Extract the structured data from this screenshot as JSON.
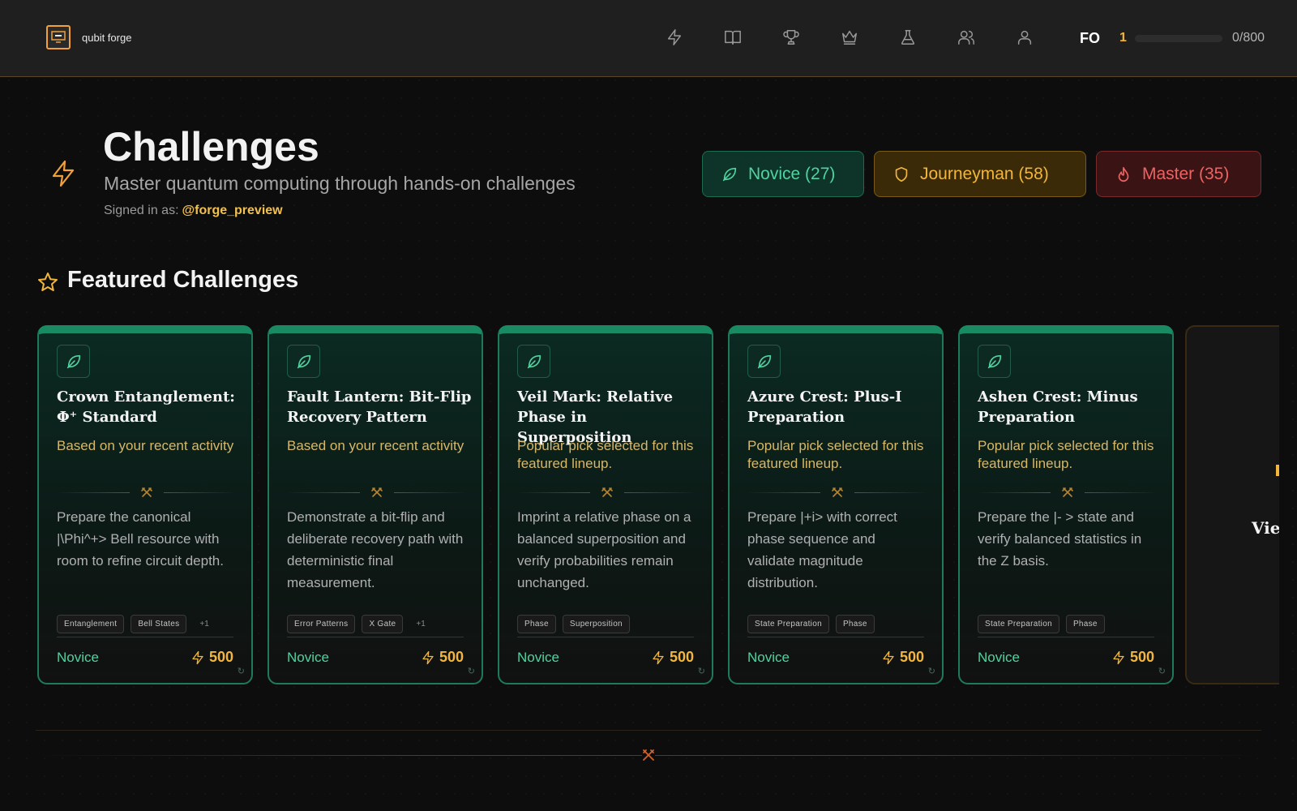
{
  "app": {
    "name": "qubit forge",
    "logo_icon": "computer-icon"
  },
  "nav": {
    "items": [
      {
        "icon": "bolt-icon",
        "label": ""
      },
      {
        "icon": "book-icon",
        "label": ""
      },
      {
        "icon": "trophy-icon",
        "label": ""
      },
      {
        "icon": "crown-icon",
        "label": ""
      },
      {
        "icon": "flask-icon",
        "label": ""
      },
      {
        "icon": "users-icon",
        "label": ""
      },
      {
        "icon": "user-icon",
        "label": ""
      }
    ]
  },
  "user": {
    "initials": "FO",
    "level": "1",
    "xp_text": "0/800",
    "xp_progress": 0.0
  },
  "header": {
    "title": "Challenges",
    "subtitle": "Master quantum computing through hands-on challenges",
    "signed_in_label": "Signed in as:",
    "handle": "@forge_preview"
  },
  "difficulty_filters": [
    {
      "label": "Novice (27)",
      "icon": "leaf-icon",
      "color": "#4fd3a0"
    },
    {
      "label": "Journeyman (58)",
      "icon": "shield-icon",
      "color": "#f2b63c"
    },
    {
      "label": "Master (35)",
      "icon": "flame-icon",
      "color": "#ee6262"
    }
  ],
  "featured": {
    "title": "Featured Challenges",
    "cards": [
      {
        "title": "Crown Entanglement: Φ⁺ Standard",
        "reason": "Based on your recent activity",
        "description": "Prepare the canonical |\\Phi^+> Bell resource with room to refine circuit depth.",
        "tags": [
          "Entanglement",
          "Bell States"
        ],
        "more": "+1",
        "level": "Novice",
        "points": "500"
      },
      {
        "title": "Fault Lantern: Bit-Flip Recovery Pattern",
        "reason": "Based on your recent activity",
        "description": "Demonstrate a bit-flip and deliberate recovery path with deterministic final measurement.",
        "tags": [
          "Error Patterns",
          "X Gate"
        ],
        "more": "+1",
        "level": "Novice",
        "points": "500"
      },
      {
        "title": "Veil Mark: Relative Phase in Superposition",
        "reason": "Popular pick selected for this featured lineup.",
        "description": "Imprint a relative phase on a balanced superposition and verify probabilities remain unchanged.",
        "tags": [
          "Phase",
          "Superposition"
        ],
        "more": "",
        "level": "Novice",
        "points": "500"
      },
      {
        "title": "Azure Crest: Plus-I Preparation",
        "reason": "Popular pick selected for this featured lineup.",
        "description": "Prepare |+i> with correct phase sequence and validate magnitude distribution.",
        "tags": [
          "State Preparation",
          "Phase"
        ],
        "more": "",
        "level": "Novice",
        "points": "500"
      },
      {
        "title": "Ashen Crest: Minus Preparation",
        "reason": "Popular pick selected for this featured lineup.",
        "description": "Prepare the |- > state and verify balanced statistics in the Z basis.",
        "tags": [
          "State Preparation",
          "Phase"
        ],
        "more": "",
        "level": "Novice",
        "points": "500"
      }
    ],
    "view_all_label": "View"
  }
}
